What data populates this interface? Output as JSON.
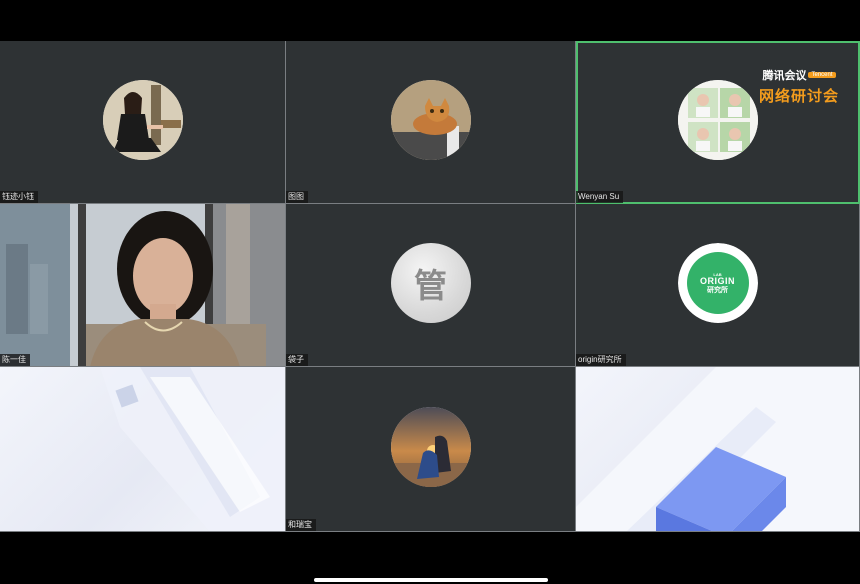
{
  "participants": [
    {
      "name": "钰迹小钰"
    },
    {
      "name": "图图"
    },
    {
      "name": "Wenyan Su"
    },
    {
      "name": "陈一佳"
    },
    {
      "name": "袋子",
      "avatar_glyph": "管"
    },
    {
      "name": "origin研究所",
      "logo": {
        "lab": "LAB",
        "text": "ORIGIN",
        "cn": "研究所"
      }
    },
    {
      "name": ""
    },
    {
      "name": "和瑞宝"
    },
    {
      "name": ""
    }
  ],
  "branding": {
    "app": "腾讯会议",
    "badge": "Tencent",
    "event": "网络研讨会"
  },
  "colors": {
    "tile_bg": "#2e3234",
    "active_border": "#4fbf6e",
    "brand_orange": "#f39c1d",
    "origin_green": "#33b269"
  }
}
